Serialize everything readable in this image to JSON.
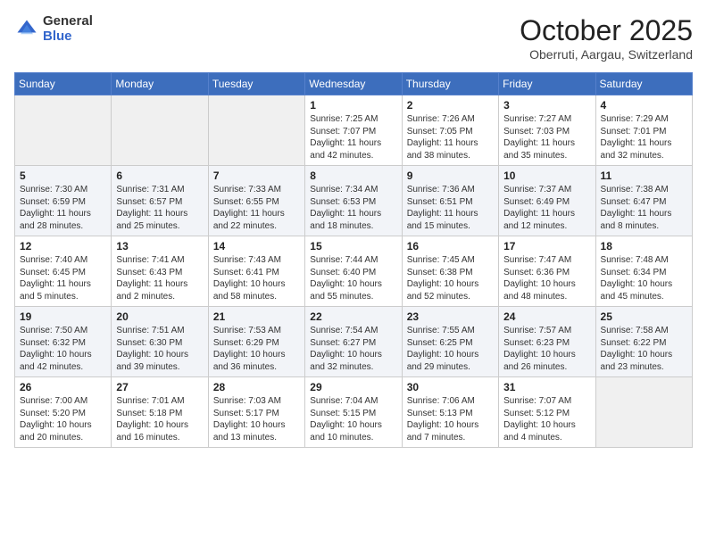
{
  "header": {
    "logo_general": "General",
    "logo_blue": "Blue",
    "month_title": "October 2025",
    "location": "Oberruti, Aargau, Switzerland"
  },
  "days_of_week": [
    "Sunday",
    "Monday",
    "Tuesday",
    "Wednesday",
    "Thursday",
    "Friday",
    "Saturday"
  ],
  "weeks": [
    [
      {
        "num": "",
        "info": ""
      },
      {
        "num": "",
        "info": ""
      },
      {
        "num": "",
        "info": ""
      },
      {
        "num": "1",
        "info": "Sunrise: 7:25 AM\nSunset: 7:07 PM\nDaylight: 11 hours\nand 42 minutes."
      },
      {
        "num": "2",
        "info": "Sunrise: 7:26 AM\nSunset: 7:05 PM\nDaylight: 11 hours\nand 38 minutes."
      },
      {
        "num": "3",
        "info": "Sunrise: 7:27 AM\nSunset: 7:03 PM\nDaylight: 11 hours\nand 35 minutes."
      },
      {
        "num": "4",
        "info": "Sunrise: 7:29 AM\nSunset: 7:01 PM\nDaylight: 11 hours\nand 32 minutes."
      }
    ],
    [
      {
        "num": "5",
        "info": "Sunrise: 7:30 AM\nSunset: 6:59 PM\nDaylight: 11 hours\nand 28 minutes."
      },
      {
        "num": "6",
        "info": "Sunrise: 7:31 AM\nSunset: 6:57 PM\nDaylight: 11 hours\nand 25 minutes."
      },
      {
        "num": "7",
        "info": "Sunrise: 7:33 AM\nSunset: 6:55 PM\nDaylight: 11 hours\nand 22 minutes."
      },
      {
        "num": "8",
        "info": "Sunrise: 7:34 AM\nSunset: 6:53 PM\nDaylight: 11 hours\nand 18 minutes."
      },
      {
        "num": "9",
        "info": "Sunrise: 7:36 AM\nSunset: 6:51 PM\nDaylight: 11 hours\nand 15 minutes."
      },
      {
        "num": "10",
        "info": "Sunrise: 7:37 AM\nSunset: 6:49 PM\nDaylight: 11 hours\nand 12 minutes."
      },
      {
        "num": "11",
        "info": "Sunrise: 7:38 AM\nSunset: 6:47 PM\nDaylight: 11 hours\nand 8 minutes."
      }
    ],
    [
      {
        "num": "12",
        "info": "Sunrise: 7:40 AM\nSunset: 6:45 PM\nDaylight: 11 hours\nand 5 minutes."
      },
      {
        "num": "13",
        "info": "Sunrise: 7:41 AM\nSunset: 6:43 PM\nDaylight: 11 hours\nand 2 minutes."
      },
      {
        "num": "14",
        "info": "Sunrise: 7:43 AM\nSunset: 6:41 PM\nDaylight: 10 hours\nand 58 minutes."
      },
      {
        "num": "15",
        "info": "Sunrise: 7:44 AM\nSunset: 6:40 PM\nDaylight: 10 hours\nand 55 minutes."
      },
      {
        "num": "16",
        "info": "Sunrise: 7:45 AM\nSunset: 6:38 PM\nDaylight: 10 hours\nand 52 minutes."
      },
      {
        "num": "17",
        "info": "Sunrise: 7:47 AM\nSunset: 6:36 PM\nDaylight: 10 hours\nand 48 minutes."
      },
      {
        "num": "18",
        "info": "Sunrise: 7:48 AM\nSunset: 6:34 PM\nDaylight: 10 hours\nand 45 minutes."
      }
    ],
    [
      {
        "num": "19",
        "info": "Sunrise: 7:50 AM\nSunset: 6:32 PM\nDaylight: 10 hours\nand 42 minutes."
      },
      {
        "num": "20",
        "info": "Sunrise: 7:51 AM\nSunset: 6:30 PM\nDaylight: 10 hours\nand 39 minutes."
      },
      {
        "num": "21",
        "info": "Sunrise: 7:53 AM\nSunset: 6:29 PM\nDaylight: 10 hours\nand 36 minutes."
      },
      {
        "num": "22",
        "info": "Sunrise: 7:54 AM\nSunset: 6:27 PM\nDaylight: 10 hours\nand 32 minutes."
      },
      {
        "num": "23",
        "info": "Sunrise: 7:55 AM\nSunset: 6:25 PM\nDaylight: 10 hours\nand 29 minutes."
      },
      {
        "num": "24",
        "info": "Sunrise: 7:57 AM\nSunset: 6:23 PM\nDaylight: 10 hours\nand 26 minutes."
      },
      {
        "num": "25",
        "info": "Sunrise: 7:58 AM\nSunset: 6:22 PM\nDaylight: 10 hours\nand 23 minutes."
      }
    ],
    [
      {
        "num": "26",
        "info": "Sunrise: 7:00 AM\nSunset: 5:20 PM\nDaylight: 10 hours\nand 20 minutes."
      },
      {
        "num": "27",
        "info": "Sunrise: 7:01 AM\nSunset: 5:18 PM\nDaylight: 10 hours\nand 16 minutes."
      },
      {
        "num": "28",
        "info": "Sunrise: 7:03 AM\nSunset: 5:17 PM\nDaylight: 10 hours\nand 13 minutes."
      },
      {
        "num": "29",
        "info": "Sunrise: 7:04 AM\nSunset: 5:15 PM\nDaylight: 10 hours\nand 10 minutes."
      },
      {
        "num": "30",
        "info": "Sunrise: 7:06 AM\nSunset: 5:13 PM\nDaylight: 10 hours\nand 7 minutes."
      },
      {
        "num": "31",
        "info": "Sunrise: 7:07 AM\nSunset: 5:12 PM\nDaylight: 10 hours\nand 4 minutes."
      },
      {
        "num": "",
        "info": ""
      }
    ]
  ]
}
